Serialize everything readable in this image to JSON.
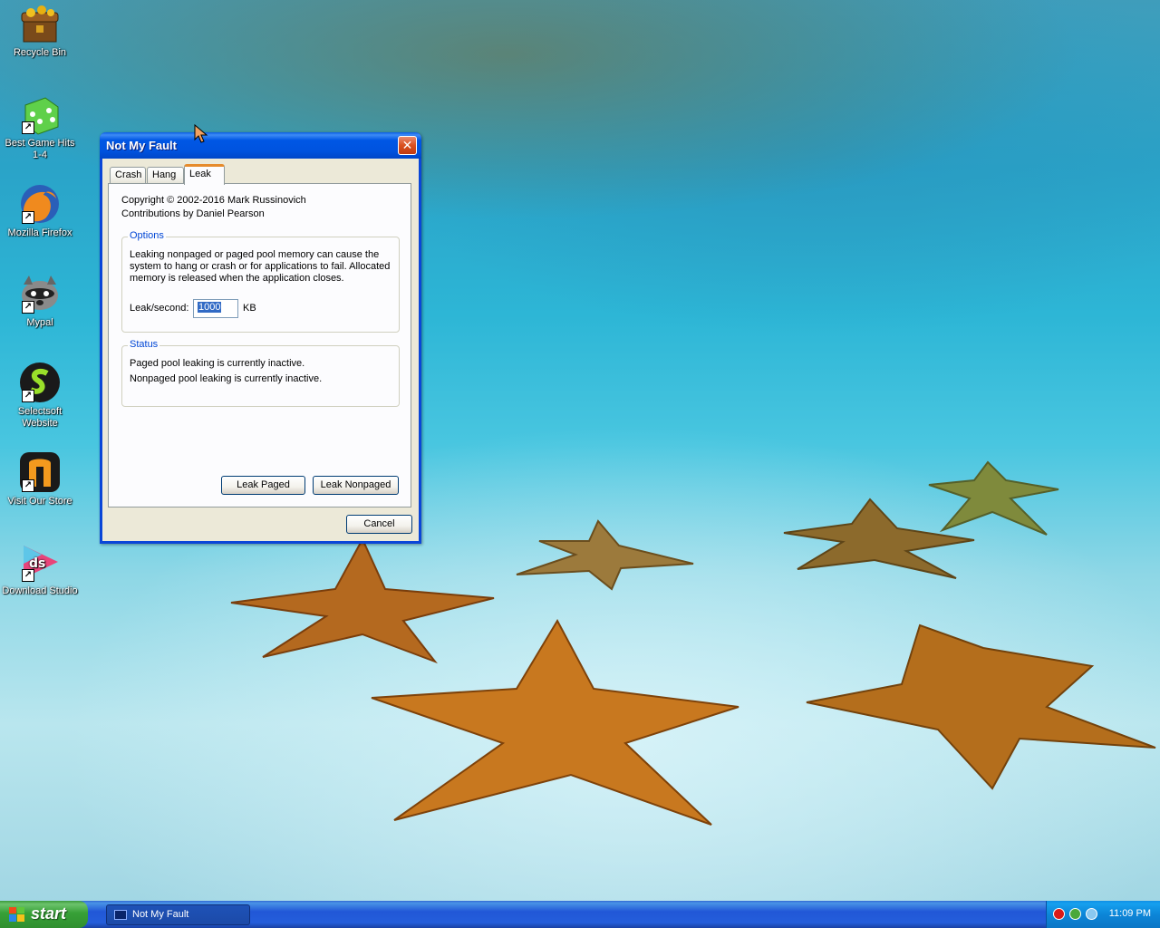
{
  "desktop": {
    "icons": [
      {
        "label": "Recycle Bin"
      },
      {
        "label": "Best Game Hits 1-4"
      },
      {
        "label": "Mozilla Firefox"
      },
      {
        "label": "Mypal"
      },
      {
        "label": "Selectsoft Website"
      },
      {
        "label": "Visit Our Store"
      },
      {
        "label": "Download Studio"
      }
    ]
  },
  "window": {
    "title": "Not My Fault",
    "close_glyph": "✕",
    "tabs": [
      {
        "label": "Crash",
        "active": false
      },
      {
        "label": "Hang",
        "active": false
      },
      {
        "label": "Leak",
        "active": true
      }
    ],
    "copyright": "Copyright © 2002-2016 Mark Russinovich",
    "contributions": "Contributions by Daniel Pearson",
    "options": {
      "legend": "Options",
      "description_lines": [
        "Leaking nonpaged or paged pool memory can cause the",
        "system to hang or crash or for applications to fail. Allocated",
        "memory is released when the application closes."
      ],
      "leak_label": "Leak/second:",
      "leak_value": "1000",
      "leak_unit": "KB"
    },
    "status": {
      "legend": "Status",
      "paged": "Paged pool leaking is currently inactive.",
      "nonpaged": "Nonpaged pool leaking is currently inactive."
    },
    "buttons": {
      "leak_paged": "Leak Paged",
      "leak_nonpaged": "Leak Nonpaged",
      "cancel": "Cancel"
    }
  },
  "taskbar": {
    "start_label": "start",
    "task_item": "Not My Fault",
    "clock": "11:09 PM"
  },
  "colors": {
    "titlebar": "#0054e3",
    "tab_highlight": "#e68b2c",
    "groupbox_legend": "#0046d5",
    "start_green": "#37a037",
    "taskbar_blue": "#245edb"
  },
  "icon_names": [
    "recycle-bin-icon",
    "game-dice-icon",
    "firefox-icon",
    "mypal-raccoon-icon",
    "selectsoft-icon",
    "store-icon",
    "download-studio-icon",
    "windows-flag-icon",
    "security-shield-icon",
    "network-icon",
    "volume-icon"
  ]
}
